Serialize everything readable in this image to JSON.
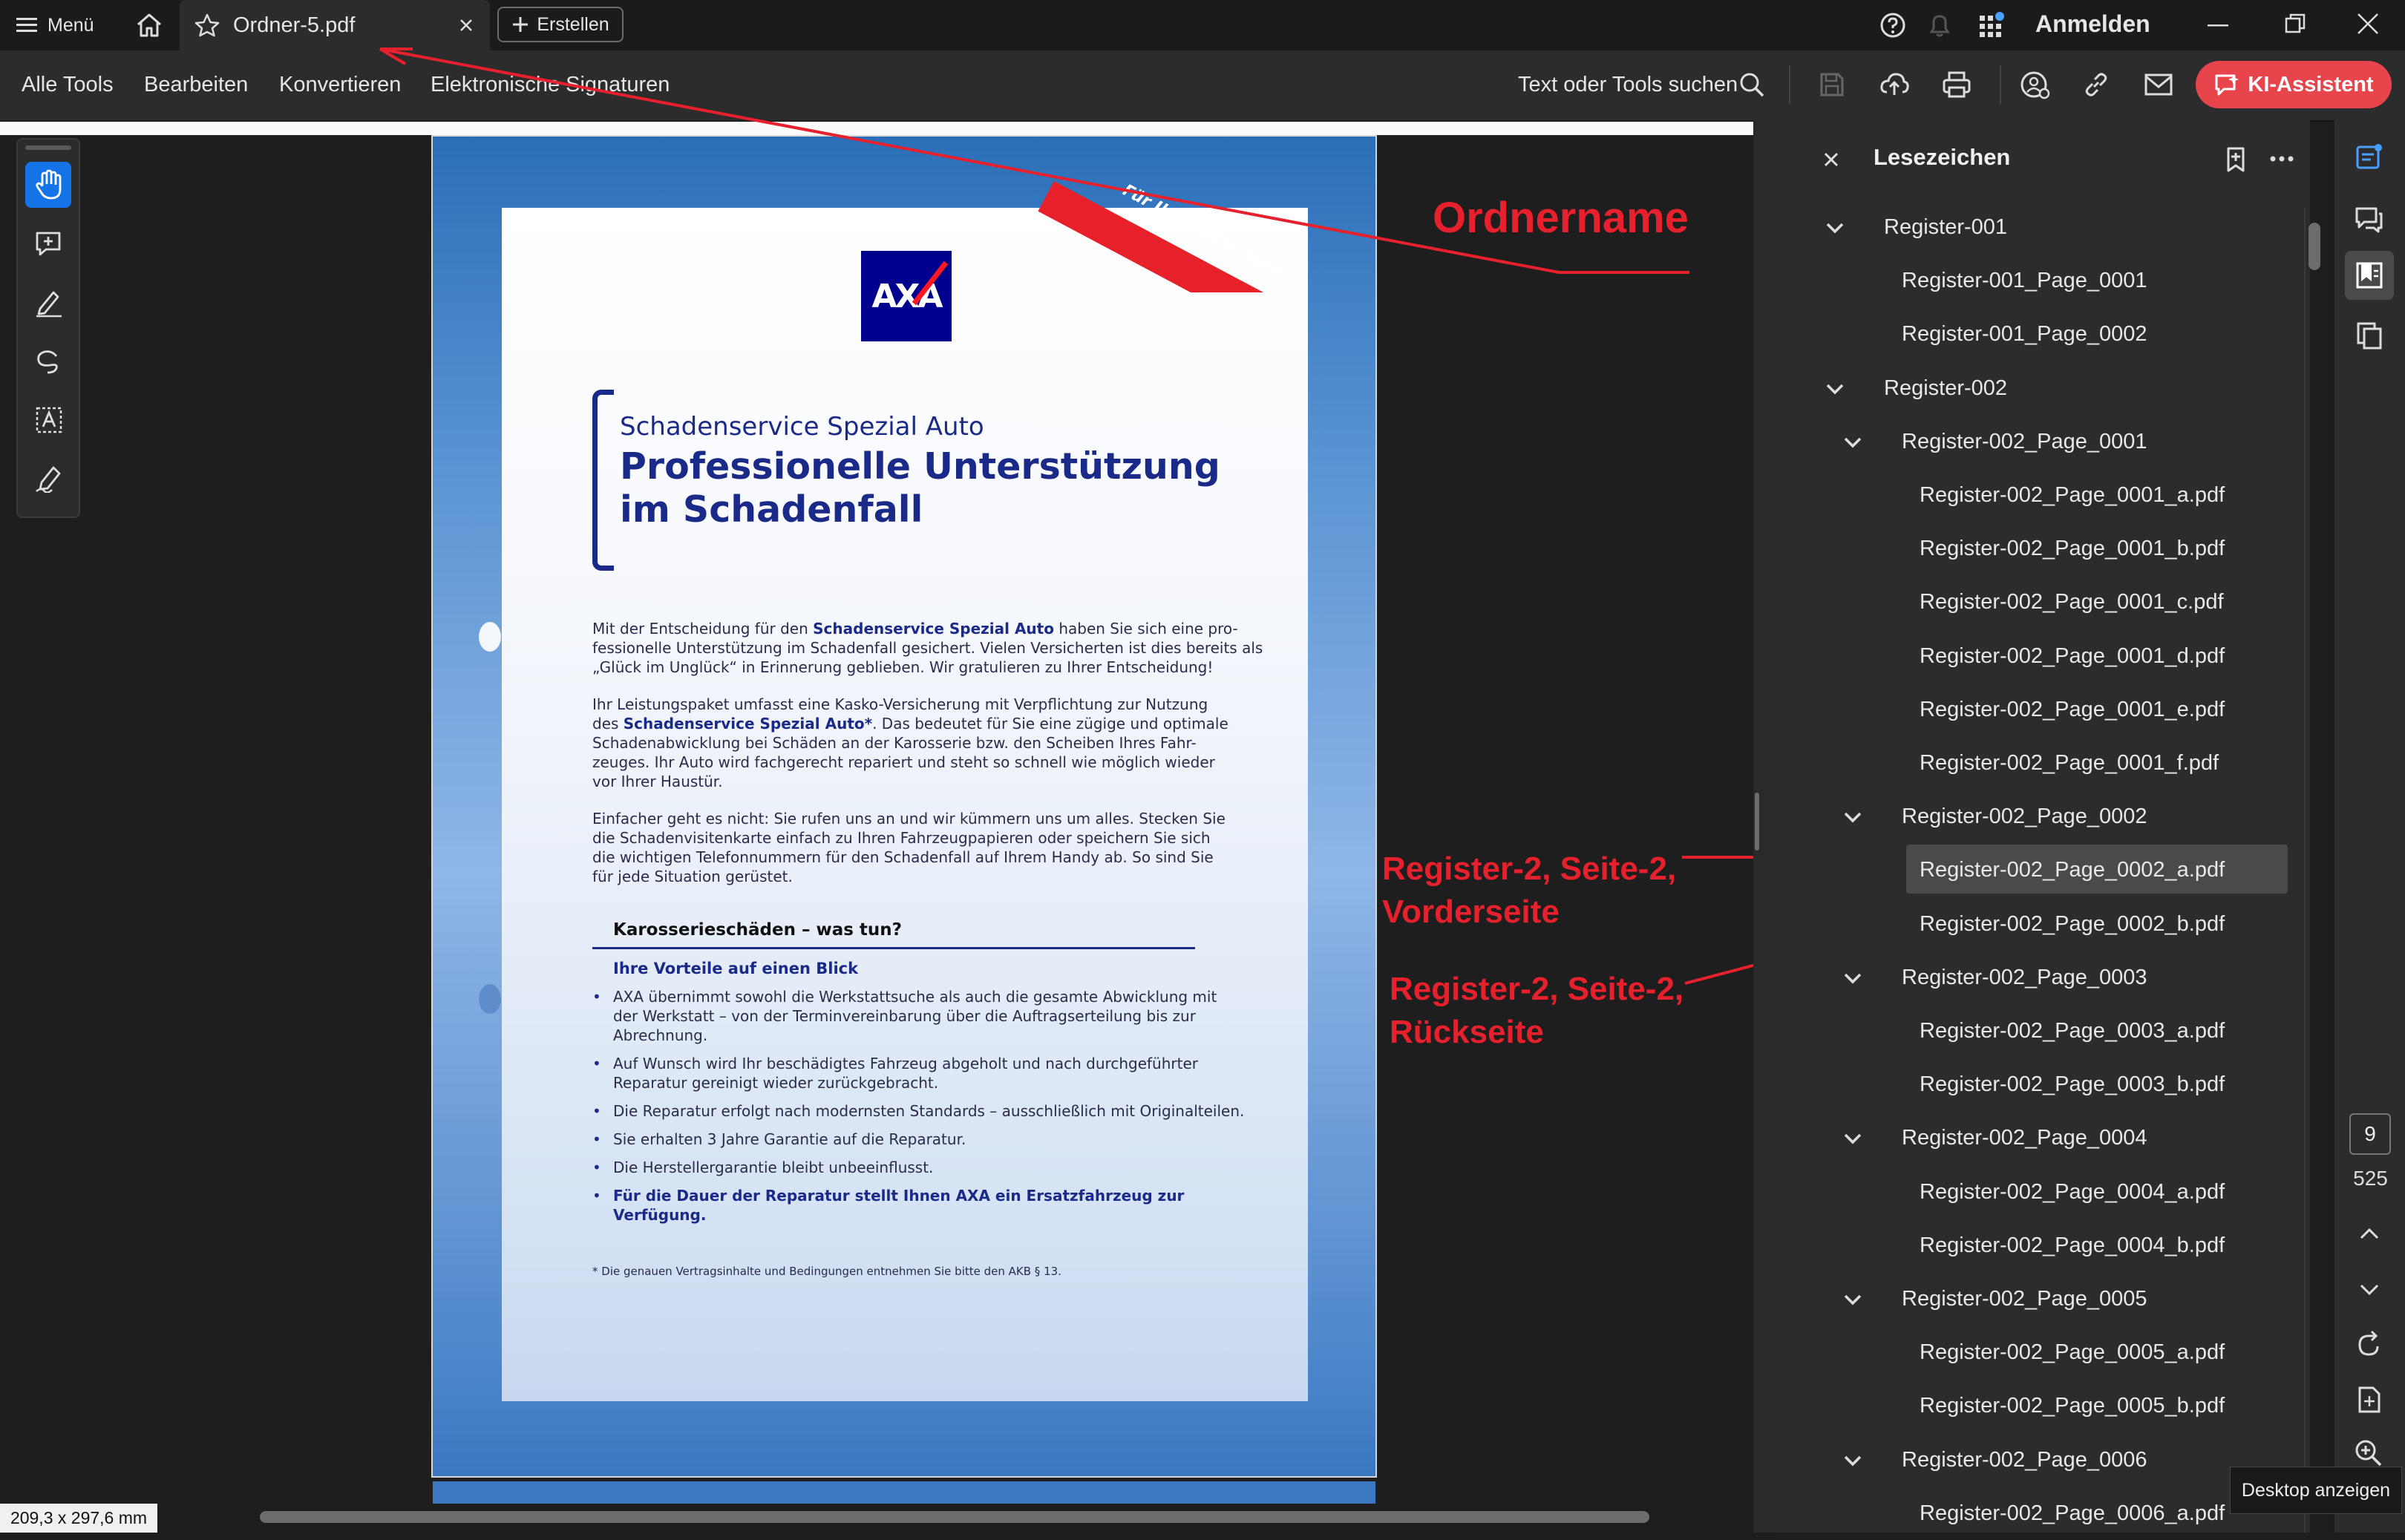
{
  "titlebar": {
    "menu_label": "Menü",
    "tab_title": "Ordner-5.pdf",
    "create_label": "Erstellen",
    "signin_label": "Anmelden"
  },
  "toolbar": {
    "items": [
      "Alle Tools",
      "Bearbeiten",
      "Konvertieren",
      "Elektronische Signaturen"
    ],
    "search_label": "Text oder Tools suchen",
    "ai_label": "KI-Assistent",
    "ai_color": "#e8444c"
  },
  "document": {
    "subtitle": "Schadenservice Spezial Auto",
    "title_line1": "Professionelle Unterstützung",
    "title_line2": "im Schadenfall",
    "banner": "Für Ihre Unterlagen!",
    "logo": "AXA",
    "para1_a": "Mit der Entscheidung für den ",
    "para1_b": "Schadenservice Spezial Auto",
    "para1_c": " haben Sie sich eine pro-",
    "para1_l2": "fessionelle Unterstützung im Schadenfall gesichert. Vielen Versicherten ist dies bereits als",
    "para1_l3": "„Glück im Unglück“ in Erinnerung geblieben. Wir gratulieren zu Ihrer Entscheidung!",
    "para2_l1": "Ihr Leistungspaket umfasst eine Kasko-Versicherung mit Verpflichtung zur Nutzung",
    "para2_l2a": "des ",
    "para2_l2b": "Schadenservice Spezial Auto*",
    "para2_l2c": ". Das bedeutet für Sie eine zügige und optimale",
    "para2_l3": "Schadenabwicklung bei Schäden an der Karosserie bzw. den Scheiben Ihres Fahr-",
    "para2_l4": "zeuges. Ihr Auto wird fachgerecht repariert und steht so schnell wie möglich wieder",
    "para2_l5": "vor Ihrer Haustür.",
    "para3_l1": "Einfacher geht es nicht: Sie rufen uns an und wir kümmern uns um alles. Stecken Sie",
    "para3_l2": "die Schadenvisitenkarte einfach zu Ihren Fahrzeugpapieren oder speichern Sie sich",
    "para3_l3": "die wichtigen Telefonnummern für den Schadenfall auf Ihrem Handy ab. So sind Sie",
    "para3_l4": "für jede Situation gerüstet.",
    "section_title": "Karosserieschäden – was tun?",
    "section_sub": "Ihre Vorteile auf einen Blick",
    "bullets": [
      [
        "AXA übernimmt sowohl die Werkstattsuche als auch die gesamte Abwicklung mit",
        "der Werkstatt – von der Terminvereinbarung über die Auftragserteilung bis zur",
        "Abrechnung."
      ],
      [
        "Auf Wunsch wird Ihr beschädigtes Fahrzeug abgeholt und nach durchgeführter",
        "Reparatur gereinigt wieder zurückgebracht."
      ],
      [
        "Die Reparatur erfolgt nach modernsten Standards – ausschließlich mit Originalteilen."
      ],
      [
        "Sie erhalten 3 Jahre Garantie auf die Reparatur."
      ],
      [
        "Die Herstellergarantie bleibt unbeeinflusst."
      ]
    ],
    "bullet_bold_l1": "Für die Dauer der Reparatur stellt Ihnen AXA ein Ersatzfahrzeug zur",
    "bullet_bold_l2": "Verfügung.",
    "footnote": "* Die genauen Vertragsinhalte und Bedingungen entnehmen Sie bitte den AKB § 13."
  },
  "status": {
    "page_size": "209,3 x 297,6 mm"
  },
  "panel": {
    "title": "Lesezeichen",
    "bookmarks": [
      "Register-001",
      "Register-001_Page_0001",
      "Register-001_Page_0002",
      "Register-002",
      "Register-002_Page_0001",
      "Register-002_Page_0001_a.pdf",
      "Register-002_Page_0001_b.pdf",
      "Register-002_Page_0001_c.pdf",
      "Register-002_Page_0001_d.pdf",
      "Register-002_Page_0001_e.pdf",
      "Register-002_Page_0001_f.pdf",
      "Register-002_Page_0002",
      "Register-002_Page_0002_a.pdf",
      "Register-002_Page_0002_b.pdf",
      "Register-002_Page_0003",
      "Register-002_Page_0003_a.pdf",
      "Register-002_Page_0003_b.pdf",
      "Register-002_Page_0004",
      "Register-002_Page_0004_a.pdf",
      "Register-002_Page_0004_b.pdf",
      "Register-002_Page_0005",
      "Register-002_Page_0005_a.pdf",
      "Register-002_Page_0005_b.pdf",
      "Register-002_Page_0006",
      "Register-002_Page_0006_a.pdf"
    ]
  },
  "rail": {
    "current_page": "9",
    "total_pages": "525",
    "tooltip": "Desktop anzeigen"
  },
  "annotations": {
    "folder_name": "Ordnername",
    "front_l1": "Register-2, Seite-2,",
    "front_l2": "Vorderseite",
    "back_l1": "Register-2, Seite-2,",
    "back_l2": "Rückseite",
    "color": "#e6202c"
  }
}
